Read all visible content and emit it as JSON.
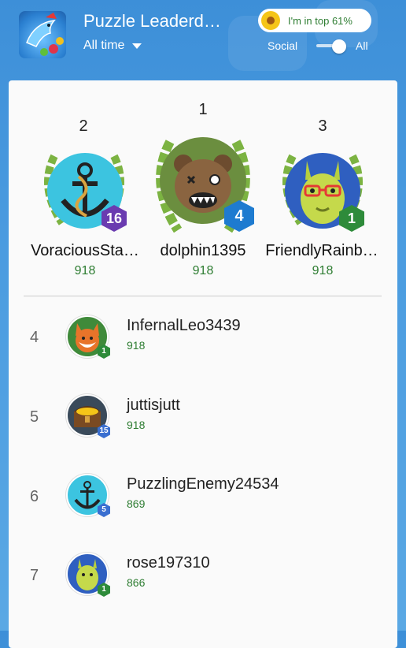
{
  "header": {
    "title": "Puzzle Leaderd…",
    "time_filter": "All time",
    "rank_pill": "I'm in top 61%",
    "toggle_left": "Social",
    "toggle_right": "All"
  },
  "podium": [
    {
      "place": "2",
      "name": "VoraciousSta…",
      "score": "918",
      "badge": "16",
      "badge_color": "#6a3bb0"
    },
    {
      "place": "1",
      "name": "dolphin1395",
      "score": "918",
      "badge": "4",
      "badge_color": "#1e7bd0"
    },
    {
      "place": "3",
      "name": "FriendlyRainb…",
      "score": "918",
      "badge": "1",
      "badge_color": "#2e8b3a"
    }
  ],
  "rows": [
    {
      "rank": "4",
      "name": "InfernalLeo3439",
      "score": "918",
      "badge": "1",
      "badge_color": "#2e8b3a"
    },
    {
      "rank": "5",
      "name": "juttisjutt",
      "score": "918",
      "badge": "15",
      "badge_color": "#3a6fd0"
    },
    {
      "rank": "6",
      "name": "PuzzlingEnemy24534",
      "score": "869",
      "badge": "5",
      "badge_color": "#3a6fd0"
    },
    {
      "rank": "7",
      "name": "rose197310",
      "score": "866",
      "badge": "1",
      "badge_color": "#2e8b3a"
    }
  ]
}
